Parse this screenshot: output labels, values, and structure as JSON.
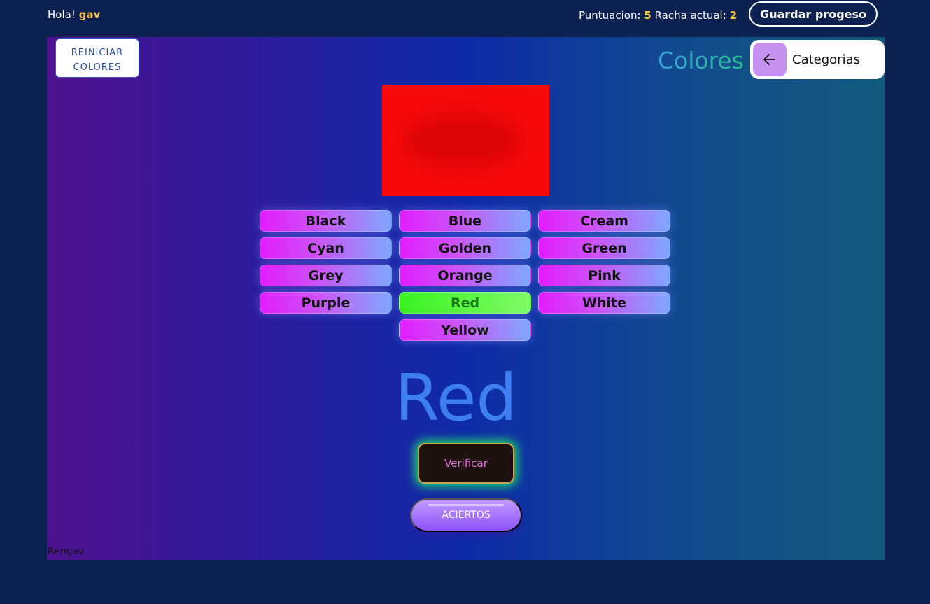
{
  "header": {
    "greeting_prefix": "Hola!",
    "username": "gav",
    "score_label": "Puntuacion:",
    "score_value": "5",
    "streak_label": "Racha actual:",
    "streak_value": "2",
    "save_label": "Guardar progeso"
  },
  "game": {
    "reset_label": "REINICIAR COLORES",
    "section_title": "Colores",
    "categories_label": "Categorias",
    "swatch_color": "#f70a0a",
    "options": [
      "Black",
      "Blue",
      "Cream",
      "Cyan",
      "Golden",
      "Green",
      "Grey",
      "Orange",
      "Pink",
      "Purple",
      "Red",
      "White",
      "Yellow"
    ],
    "selected_option": "Red",
    "answer_display": "Red",
    "verify_label": "Verificar",
    "hits_label": "ACIERTOS",
    "footer_name": "Rengav"
  },
  "colors": {
    "accent_yellow": "#f5c542",
    "option_selected": "#39f21f",
    "answer_blue": "#3d7ff0"
  },
  "icons": {
    "back": "arrow-left-icon"
  }
}
